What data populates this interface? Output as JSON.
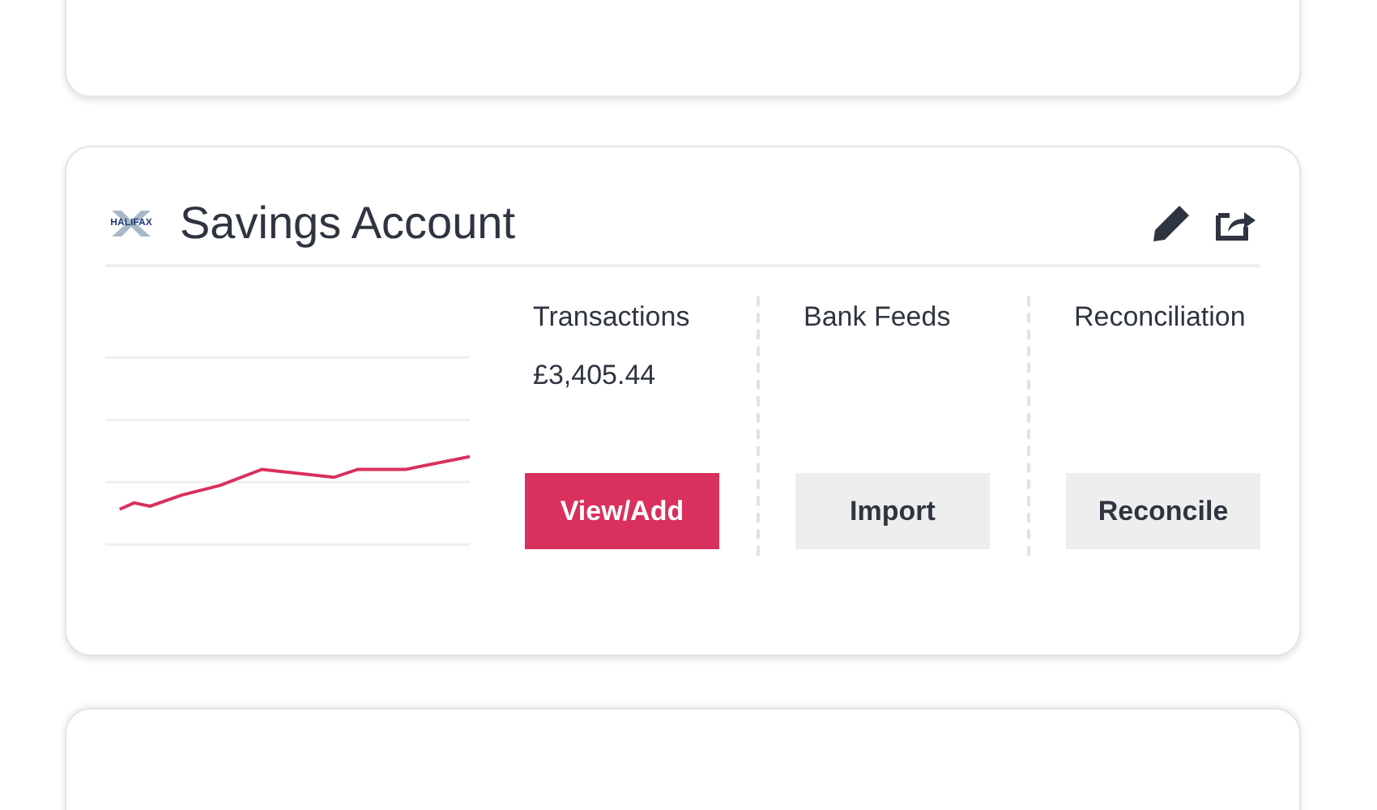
{
  "account": {
    "logo_text": "HALIFAX",
    "title": "Savings Account",
    "sections": [
      {
        "title": "Transactions",
        "value": "£3,405.44",
        "button": {
          "label": "View/Add",
          "kind": "primary"
        }
      },
      {
        "title": "Bank Feeds",
        "button": {
          "label": "Import",
          "kind": "secondary"
        }
      },
      {
        "title": "Reconciliation",
        "button": {
          "label": "Reconcile",
          "kind": "secondary"
        }
      }
    ]
  }
}
